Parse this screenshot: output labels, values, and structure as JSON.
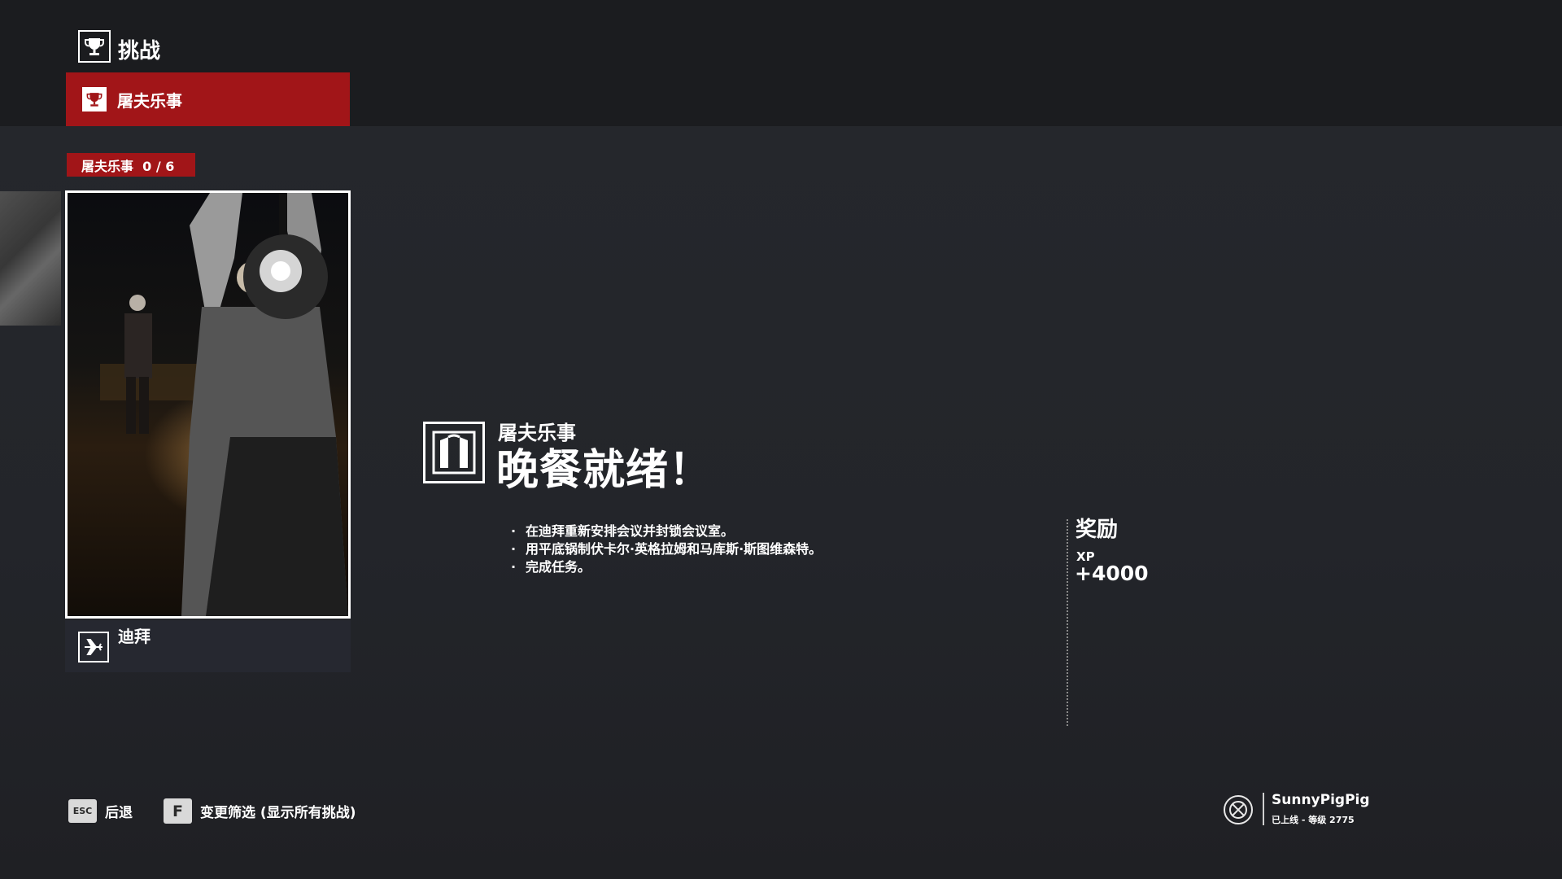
{
  "header": {
    "section_title": "挑战",
    "category_tab": "屠夫乐事"
  },
  "progress": {
    "badge": "屠夫乐事  0 / 6",
    "completed": 0,
    "total": 6
  },
  "card": {
    "location": "迪拜"
  },
  "challenge": {
    "category": "屠夫乐事",
    "title": "晚餐就绪！",
    "objectives": [
      "在迪拜重新安排会议并封锁会议室。",
      "用平底锅制伏卡尔·英格拉姆和马库斯·斯图维森特。",
      "完成任务。"
    ]
  },
  "reward": {
    "title": "奖励",
    "label": "XP",
    "value": "+4000"
  },
  "hints": {
    "back_key": "ESC",
    "back_label": "后退",
    "filter_key": "F",
    "filter_label": "变更筛选 (显示所有挑战)"
  },
  "user": {
    "name": "SunnyPigPig",
    "status": "已上线 - 等级 2775"
  },
  "icons": {
    "header": "trophy-icon",
    "tab": "trophy-icon",
    "challenge": "gate-icon",
    "location": "airplane-icon",
    "profile": "emblem-icon"
  },
  "colors": {
    "accent": "#a11518",
    "background": "#23252a",
    "topbar": "#1b1c1f"
  }
}
